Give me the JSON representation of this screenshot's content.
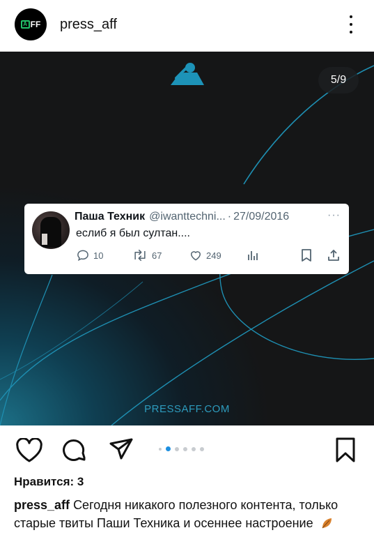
{
  "header": {
    "username": "press_aff",
    "avatar_text": "FF"
  },
  "post": {
    "counter": "5/9",
    "watermark": "PRESSAFF.COM",
    "colors": {
      "accent": "#1a9fc4",
      "background": "#151617"
    }
  },
  "tweet": {
    "name": "Паша Техник",
    "handle": "@iwanttechni...",
    "separator": "·",
    "date": "27/09/2016",
    "menu": "···",
    "text": "еслиб я был султан....",
    "replies": "10",
    "retweets": "67",
    "likes": "249"
  },
  "actions": {
    "icons": [
      "heart-icon",
      "comment-icon",
      "send-icon",
      "bookmark-icon"
    ],
    "carousel_total": 6,
    "carousel_active": 2
  },
  "likes": {
    "label": "Нравится:",
    "count": "3"
  },
  "caption": {
    "username": "press_aff",
    "text": "Сегодня никакого полезного контента, только старые твиты Паши Техника и осеннее настроение"
  }
}
